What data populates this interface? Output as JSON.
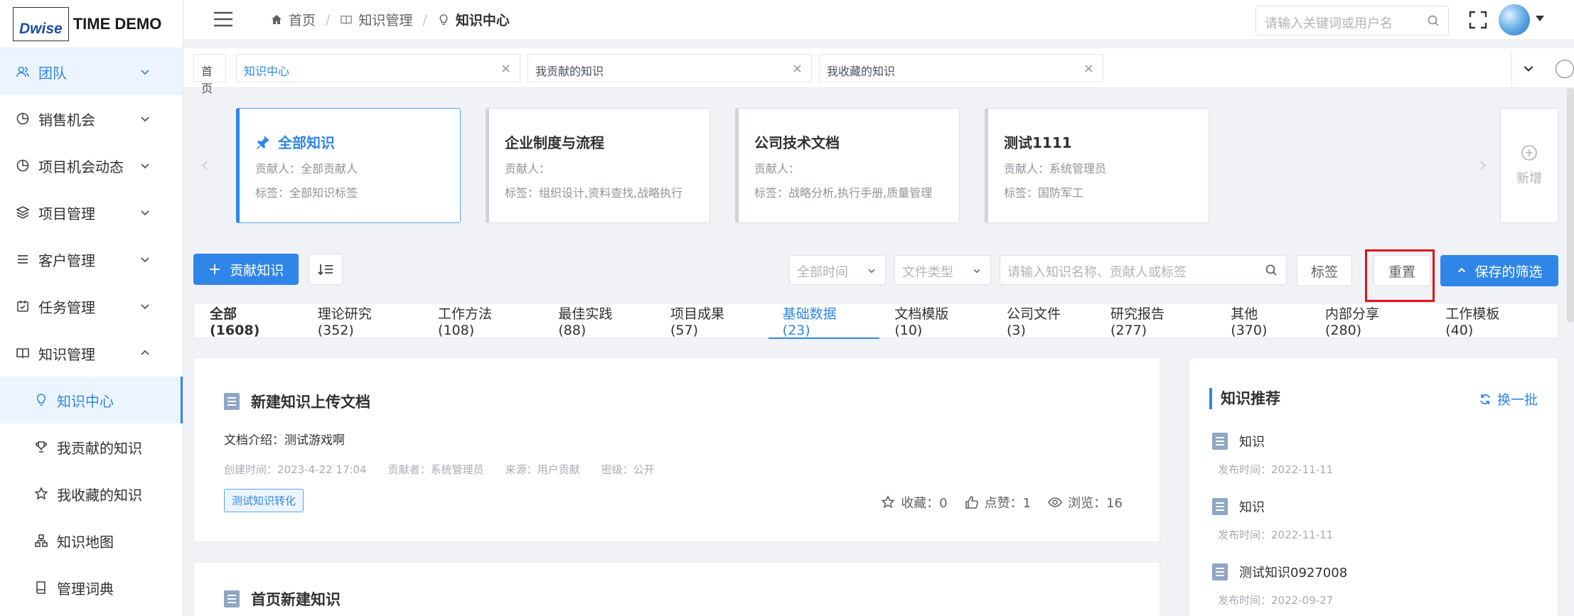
{
  "brand": {
    "logo": "Dwise",
    "name": "TIME DEMO"
  },
  "sidebar": {
    "items": [
      {
        "label": "团队",
        "icon": "team-icon",
        "active": true
      },
      {
        "label": "销售机会",
        "icon": "pie-chart-icon"
      },
      {
        "label": "项目机会动态",
        "icon": "pie-chart-icon"
      },
      {
        "label": "项目管理",
        "icon": "layers-icon"
      },
      {
        "label": "客户管理",
        "icon": "list-icon"
      },
      {
        "label": "任务管理",
        "icon": "calendar-check-icon"
      },
      {
        "label": "知识管理",
        "icon": "book-icon",
        "expanded": true
      }
    ],
    "sub": [
      {
        "label": "知识中心",
        "icon": "lightbulb-icon",
        "active": true
      },
      {
        "label": "我贡献的知识",
        "icon": "trophy-icon"
      },
      {
        "label": "我收藏的知识",
        "icon": "star-icon"
      },
      {
        "label": "知识地图",
        "icon": "sitemap-icon"
      },
      {
        "label": "管理词典",
        "icon": "dictionary-icon"
      }
    ]
  },
  "header": {
    "breadcrumb": [
      "首页",
      "知识管理",
      "知识中心"
    ],
    "search_placeholder": "请输入关键词或用户名"
  },
  "tabs": [
    {
      "label": "首页"
    },
    {
      "label": "知识中心",
      "active": true
    },
    {
      "label": "我贡献的知识"
    },
    {
      "label": "我收藏的知识"
    }
  ],
  "categories": [
    {
      "title": "全部知识",
      "contributor": "贡献人：全部贡献人",
      "tags": "标签：全部知识标签",
      "active": true
    },
    {
      "title": "企业制度与流程",
      "contributor": "贡献人：",
      "tags": "标签：组织设计,资料查找,战略执行"
    },
    {
      "title": "公司技术文档",
      "contributor": "贡献人：",
      "tags": "标签：战略分析,执行手册,质量管理"
    },
    {
      "title": "测试1111",
      "contributor": "贡献人：系统管理员",
      "tags": "标签：国防军工"
    }
  ],
  "add_label": "新增",
  "toolbar": {
    "contribute": "贡献知识",
    "time_select": "全部时间",
    "type_select": "文件类型",
    "search_placeholder": "请输入知识名称、贡献人或标签",
    "tags_button": "标签",
    "reset_button": "重置",
    "saved_filter": "保存的筛选"
  },
  "filter_tabs": [
    "全部 (1608)",
    "理论研究 (352)",
    "工作方法 (108)",
    "最佳实践 (88)",
    "项目成果 (57)",
    "基础数据 (23)",
    "文档模版 (10)",
    "公司文件 (3)",
    "研究报告 (277)",
    "其他 (370)",
    "内部分享 (280)",
    "工作模板 (40)"
  ],
  "knowledge": [
    {
      "title": "新建知识上传文档",
      "desc": "文档介绍：测试游戏啊",
      "created": "创建时间：2023-4-22 17:04",
      "author": "贡献者：系统管理员",
      "source": "来源：用户贡献",
      "level": "密级：公开",
      "tag": "测试知识转化",
      "favorites": "收藏：0",
      "likes": "点赞：1",
      "views": "浏览：16"
    },
    {
      "title": "首页新建知识"
    }
  ],
  "recommend": {
    "title": "知识推荐",
    "refresh": "换一批",
    "items": [
      {
        "name": "知识",
        "date": "发布时间：2022-11-11"
      },
      {
        "name": "知识",
        "date": "发布时间：2022-11-11"
      },
      {
        "name": "测试知识0927008",
        "date": "发布时间：2022-09-27"
      }
    ]
  },
  "colors": {
    "accent": "#2f86e8",
    "highlight": "#e0121d"
  }
}
